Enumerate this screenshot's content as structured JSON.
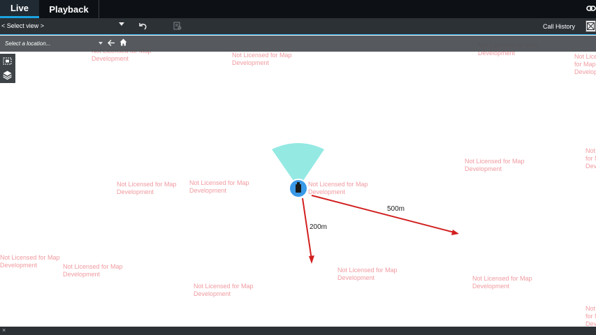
{
  "tabs": [
    {
      "label": "Live",
      "active": true
    },
    {
      "label": "Playback",
      "active": false
    }
  ],
  "toolbar": {
    "select_view": "< Select view >",
    "call_history": "Call History"
  },
  "location": {
    "placeholder": "Select a location..."
  },
  "map": {
    "watermark_line1": "Not Licensed for Map",
    "watermark_line2": "Development",
    "camera_icon": "camera-icon",
    "fov_color": "#7fe5de",
    "camera_color": "#3b9ae8",
    "arrows": [
      {
        "label": "200m",
        "color": "#d21f1f"
      },
      {
        "label": "500m",
        "color": "#d21f1f"
      }
    ]
  },
  "icons": {
    "undo": "undo-icon",
    "document": "document-icon",
    "link": "link-icon",
    "fullscreen": "fullscreen-icon",
    "back": "arrow-left-icon",
    "home": "home-icon",
    "select_area": "select-area-icon",
    "layers": "layers-icon",
    "close": "close-icon"
  },
  "bottom": {
    "close_glyph": "×"
  }
}
